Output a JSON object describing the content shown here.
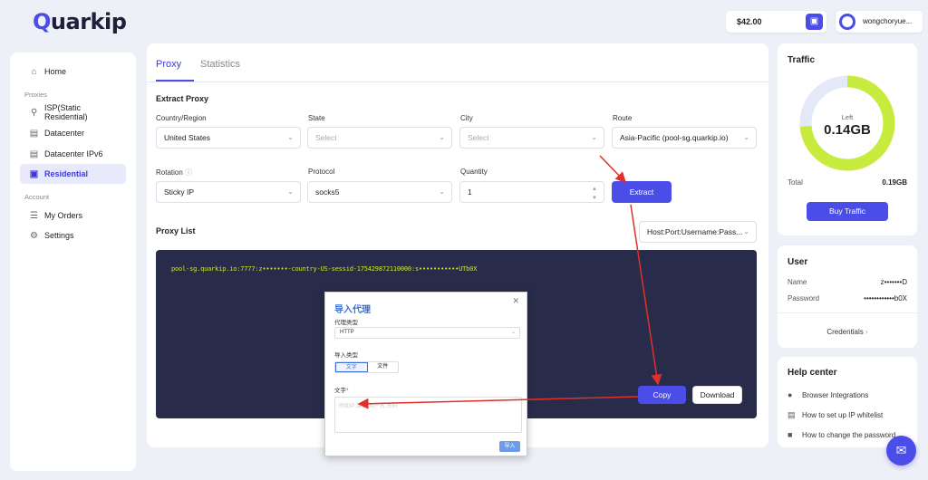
{
  "brand": {
    "name": "uarkip",
    "initial": "Q"
  },
  "header": {
    "balance": "$42.00",
    "wallet_icon": "wallet-icon",
    "username": "wongchoryue..."
  },
  "sidebar": {
    "home": "Home",
    "group_proxies": "Proxies",
    "isp": "ISP(Static Residential)",
    "datacenter": "Datacenter",
    "datacenter_ipv6": "Datacenter IPv6",
    "residential": "Residential",
    "group_account": "Account",
    "my_orders": "My Orders",
    "settings": "Settings"
  },
  "tabs": {
    "proxy": "Proxy",
    "statistics": "Statistics"
  },
  "extract": {
    "title": "Extract Proxy",
    "country_label": "Country/Region",
    "country_value": "United States",
    "state_label": "State",
    "state_placeholder": "Select",
    "city_label": "City",
    "city_placeholder": "Select",
    "route_label": "Route",
    "route_value": "Asia-Pacific (pool-sg.quarkip.io)",
    "rotation_label": "Rotation",
    "rotation_value": "Sticky IP",
    "protocol_label": "Protocol",
    "protocol_value": "socks5",
    "quantity_label": "Quantity",
    "quantity_value": "1",
    "extract_button": "Extract"
  },
  "proxy_list": {
    "title": "Proxy List",
    "format_value": "Host:Port:Username:Pass...",
    "line": "pool-sg.quarkip.io:7777:z•••••••-country-US-sessid-175429872110000:s•••••••••••UTb0X",
    "copy_button": "Copy",
    "download_button": "Download"
  },
  "traffic": {
    "title": "Traffic",
    "left_label": "Left",
    "left_value": "0.14GB",
    "total_label": "Total",
    "total_value": "0.19GB",
    "buy_button": "Buy Traffic",
    "remaining_fraction": 0.737
  },
  "user_card": {
    "title": "User",
    "name_label": "Name",
    "name_value": "z•••••••D",
    "password_label": "Password",
    "password_value": "••••••••••••b0X",
    "credentials_link": "Credentials"
  },
  "help": {
    "title": "Help center",
    "item1": "Browser Integrations",
    "item2": "How to set up IP whitelist",
    "item3": "How to change the password"
  },
  "dialog": {
    "title": "导入代理",
    "proxy_type_label": "代理类型",
    "proxy_type_value": "HTTP",
    "import_type_label": "导入类型",
    "tab_text": "文字",
    "tab_file": "文件",
    "text_label": "文字",
    "required_mark": "*",
    "textarea_placeholder": "例如IP:端口:用户名:密码",
    "submit_button": "导入"
  },
  "colors": {
    "accent": "#4b4de8",
    "proxy_text": "#c9e63a",
    "traffic_ring": "#c8ec3e",
    "arrow": "#e0302a"
  }
}
